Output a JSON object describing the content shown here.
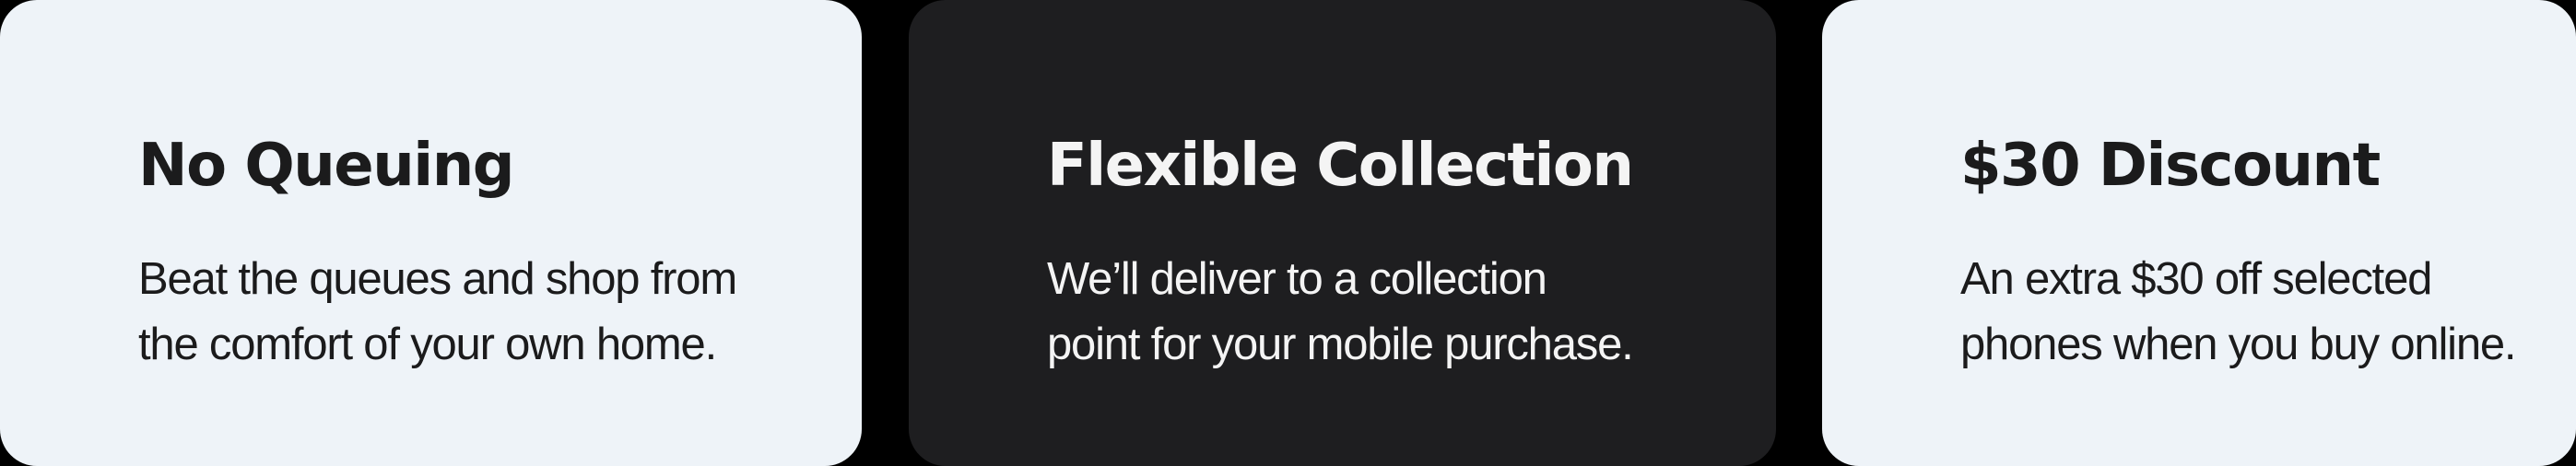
{
  "cards": [
    {
      "title": "No Queuing",
      "text_lines": [
        "Beat the queues and shop from",
        "the comfort of your own home."
      ]
    },
    {
      "title": "Flexible Collection",
      "text_lines": [
        "We’ll deliver to a collection",
        "point for your mobile purchase."
      ]
    },
    {
      "title": "$30 Discount",
      "text_lines": [
        "An extra $30 off selected",
        "phones when you buy online."
      ]
    }
  ],
  "colors": {
    "background": "#000000",
    "light_card": "#eef3f8",
    "dark_card": "#1e1e20",
    "dark_text": "#1b1b1c",
    "light_text": "#f4f4f4"
  }
}
